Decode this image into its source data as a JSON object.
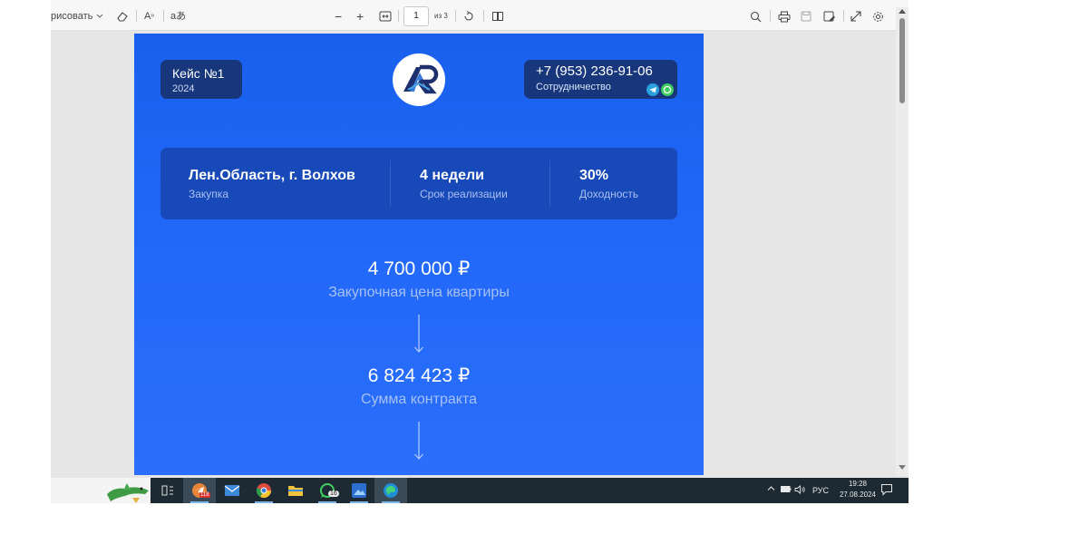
{
  "toolbar": {
    "draw_label": "рисовать",
    "read_aloud_label": "A",
    "text_tool_label": "aあ",
    "zoom_out": "−",
    "zoom_in": "+",
    "page_current": "1",
    "page_total": "из 3"
  },
  "document": {
    "case_title": "Кейс №1",
    "case_year": "2024",
    "phone": "+7 (953) 236-91-06",
    "cooperation": "Сотрудничество",
    "stats": [
      {
        "title": "Лен.Область, г. Волхов",
        "subtitle": "Закупка"
      },
      {
        "title": "4 недели",
        "subtitle": "Срок реализации"
      },
      {
        "title": "30%",
        "subtitle": "Доходность"
      }
    ],
    "purchase_price": "4 700 000 ₽",
    "purchase_price_label": "Закупочная цена квартиры",
    "contract_sum": "6 824 423 ₽",
    "contract_sum_label": "Сумма контракта"
  },
  "taskbar": {
    "apps": [
      "taskview-icon",
      "telegram-icon",
      "mail-icon",
      "chrome-icon",
      "file-explorer-icon",
      "whatsapp-icon",
      "photos-icon",
      "edge-icon"
    ],
    "telegram_badge": "118",
    "whatsapp_badge": "16",
    "language": "РУС",
    "time": "19:28",
    "date": "27.08.2024"
  },
  "colors": {
    "page_blue": "#2369fa",
    "pill_dark": "#17367b",
    "info_panel": "#1849b8",
    "taskbar": "#1d2a34"
  }
}
